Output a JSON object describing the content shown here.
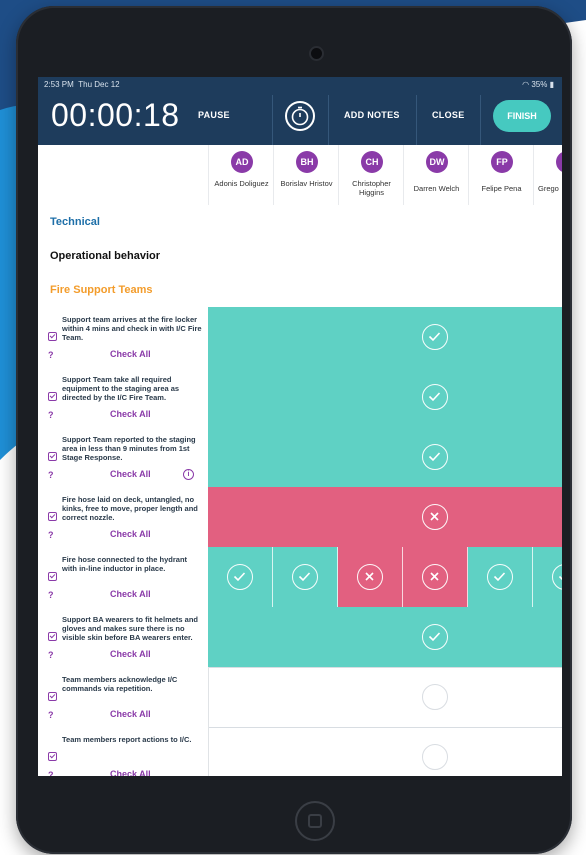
{
  "status_bar": {
    "time": "2:53 PM",
    "date": "Thu Dec 12",
    "battery": "35%"
  },
  "topbar": {
    "timer": "00:00:18",
    "pause": "PAUSE",
    "add_notes": "ADD NOTES",
    "close": "CLOSE",
    "finish": "FINISH"
  },
  "people": [
    {
      "initials": "AD",
      "name": "Adonis Doliguez"
    },
    {
      "initials": "BH",
      "name": "Borislav Hristov"
    },
    {
      "initials": "CH",
      "name": "Christopher Higgins"
    },
    {
      "initials": "DW",
      "name": "Darren Welch"
    },
    {
      "initials": "FP",
      "name": "Felipe Pena"
    },
    {
      "initials": "G",
      "name": "Grego"
    }
  ],
  "sections": {
    "technical": "Technical",
    "operational": "Operational behavior",
    "fire_support": "Fire Support Teams"
  },
  "check_all": "Check All",
  "question_mark": "?",
  "rows": [
    {
      "text": "Support team arrives at the fire locker within 4 mins and check in with I/C Fire Team.",
      "status": "pass"
    },
    {
      "text": "Support Team take all required equipment to the staging area as directed by the I/C Fire Team.",
      "status": "pass"
    },
    {
      "text": "Support Team reported to the staging area in less than 9 minutes from 1st Stage Response.",
      "status": "pass"
    },
    {
      "text": "Fire hose laid on deck, untangled, no kinks, free to move, proper length and correct nozzle.",
      "status": "fail"
    },
    {
      "text": "Fire hose connected to the hydrant with in-line inductor in place.",
      "status": "mixed"
    },
    {
      "text": "Support BA wearers to fit helmets and gloves and makes sure there is no visible skin before BA wearers enter.",
      "status": "pass"
    },
    {
      "text": "Team members acknowledge I/C commands via repetition.",
      "status": "empty"
    },
    {
      "text": "Team members report actions to I/C.",
      "status": "empty"
    }
  ],
  "colors": {
    "topbar": "#1e3c5c",
    "teal": "#5fd1c4",
    "red": "#e26080",
    "purple": "#8a3aa8",
    "orange": "#f39c2b",
    "accent": "#46c9c0"
  }
}
